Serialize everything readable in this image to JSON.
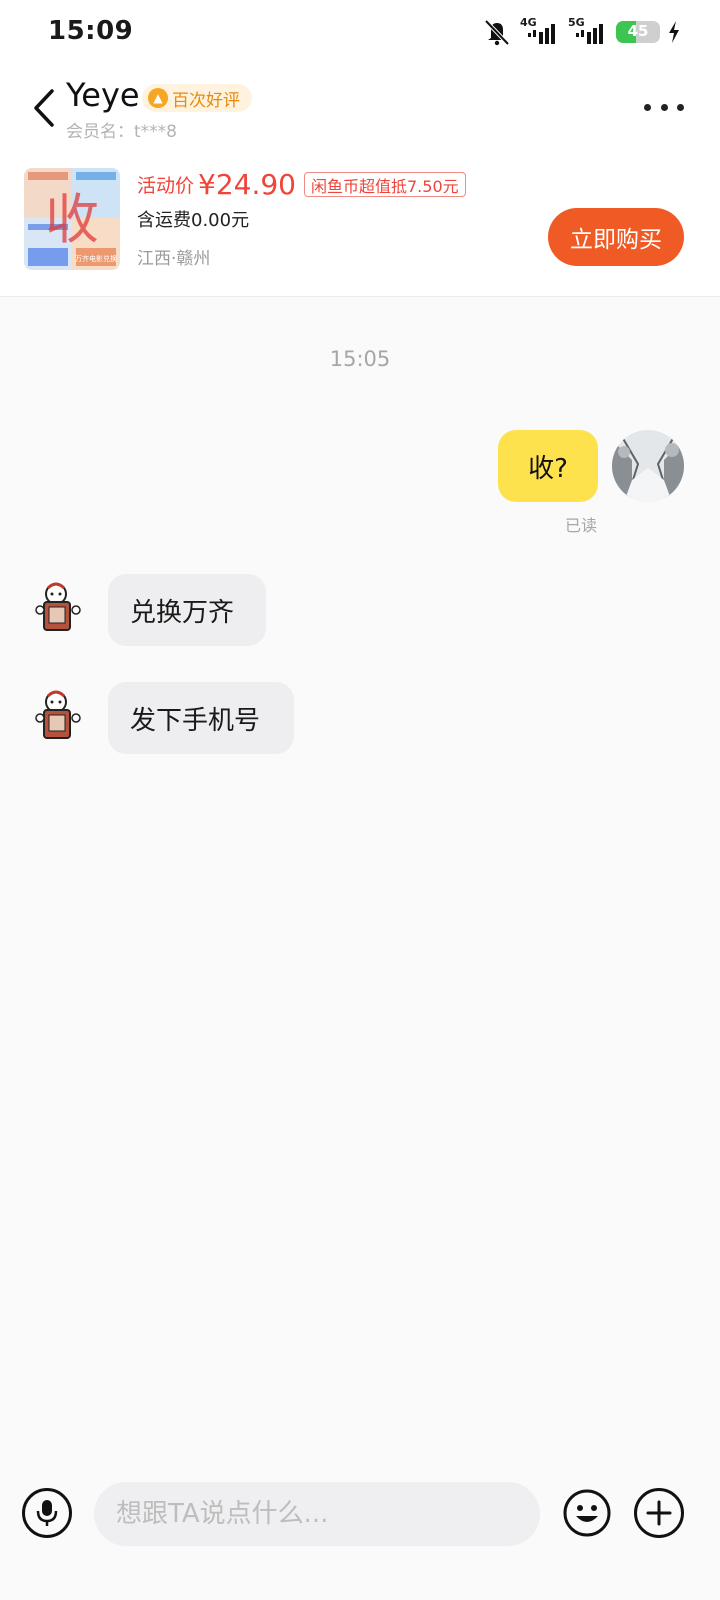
{
  "status_bar": {
    "time": "15:09",
    "network_1": "4G",
    "network_2": "5G",
    "battery_level": "45",
    "battery_fraction": 0.45
  },
  "header": {
    "seller_name": "Yeye",
    "badge": "百次好评",
    "member_label": "会员名：",
    "member_name": "t***8"
  },
  "product": {
    "price_label": "活动价",
    "price": "¥24.90",
    "coin_tag": "闲鱼币超值抵7.50元",
    "shipping": "含运费0.00元",
    "location": "江西·赣州",
    "buy_label": "立即购买",
    "thumb_text": "收",
    "thumb_caption": "万齐电影兑换"
  },
  "chat": {
    "timestamp": "15:05",
    "messages": [
      {
        "from": "self",
        "text": "收?",
        "status": "已读"
      },
      {
        "from": "other",
        "text": "兑换万齐"
      },
      {
        "from": "other",
        "text": "发下手机号"
      }
    ]
  },
  "input": {
    "placeholder": "想跟TA说点什么..."
  },
  "colors": {
    "accent_orange": "#f05a24",
    "price_red": "#f0443a",
    "self_bubble": "#fde24e",
    "other_bubble": "#eeeef0"
  },
  "icons": {
    "back": "chevron-left-icon",
    "more": "more-icon",
    "mute": "bell-off-icon",
    "charging": "bolt-icon",
    "mic": "microphone-icon",
    "emoji": "smiley-icon",
    "plus": "plus-icon"
  }
}
